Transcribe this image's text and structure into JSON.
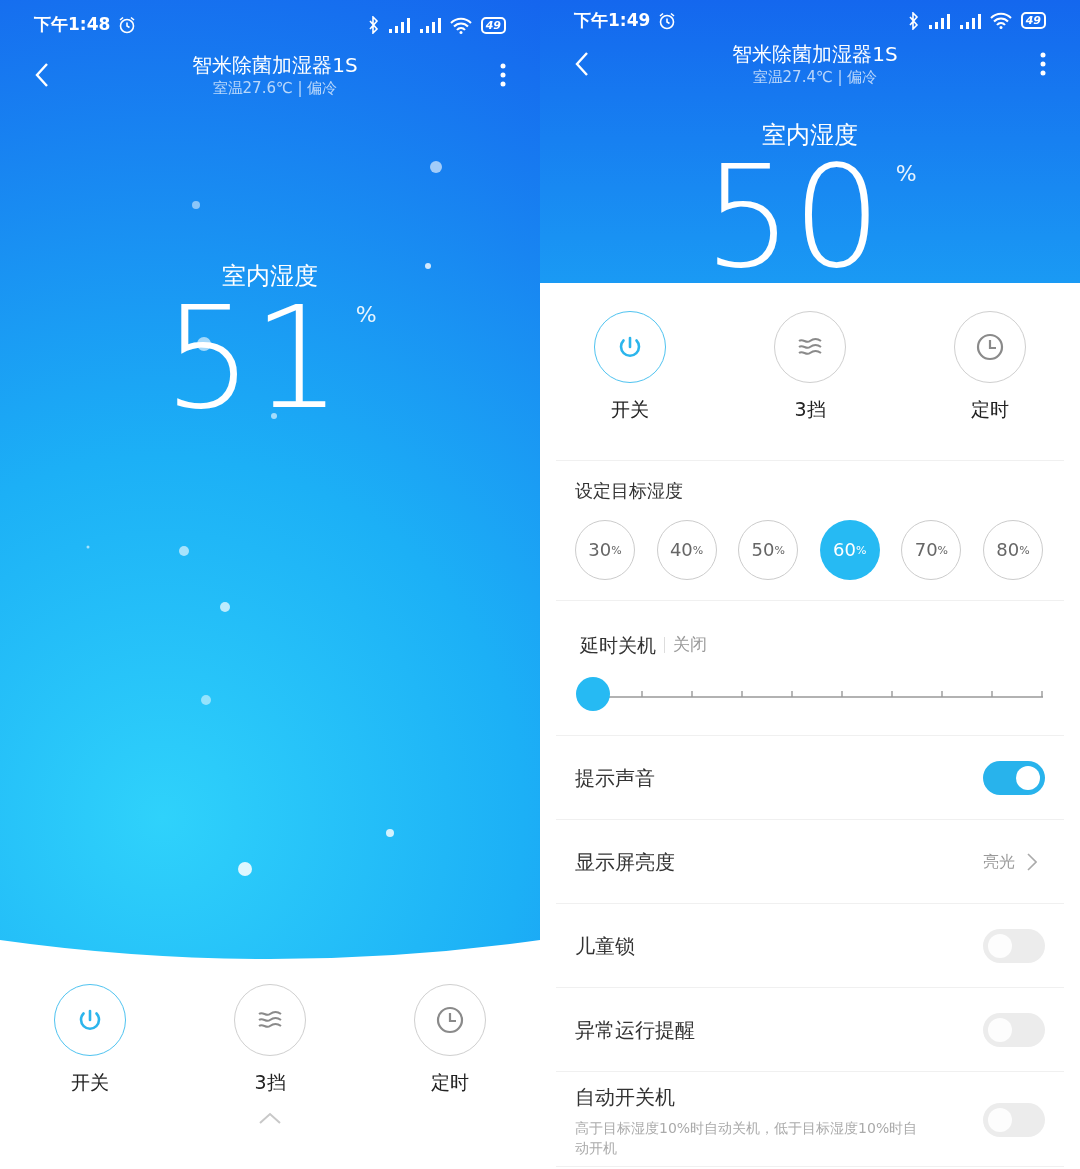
{
  "screens": [
    {
      "status_bar": {
        "time": "下午1:48",
        "battery": "49"
      },
      "header": {
        "title": "智米除菌加湿器1S",
        "subtitle": "室温27.6℃ | 偏冷"
      },
      "humidity": {
        "label": "室内湿度",
        "value": "51",
        "unit": "%"
      },
      "controls": [
        {
          "kind": "power",
          "label": "开关",
          "on": true
        },
        {
          "kind": "fan",
          "label": "3挡",
          "on": false
        },
        {
          "kind": "timer",
          "label": "定时",
          "on": false
        }
      ],
      "expand_arrow": true
    },
    {
      "status_bar": {
        "time": "下午1:49",
        "battery": "49"
      },
      "header": {
        "title": "智米除菌加湿器1S",
        "subtitle": "室温27.4℃ | 偏冷"
      },
      "humidity": {
        "label": "室内湿度",
        "value": "50",
        "unit": "%"
      },
      "controls": [
        {
          "kind": "power",
          "label": "开关",
          "on": true
        },
        {
          "kind": "fan",
          "label": "3挡",
          "on": false
        },
        {
          "kind": "timer",
          "label": "定时",
          "on": false
        }
      ],
      "target_humidity": {
        "label": "设定目标湿度",
        "options": [
          {
            "value": "30",
            "unit": "%",
            "selected": false
          },
          {
            "value": "40",
            "unit": "%",
            "selected": false
          },
          {
            "value": "50",
            "unit": "%",
            "selected": false
          },
          {
            "value": "60",
            "unit": "%",
            "selected": true
          },
          {
            "value": "70",
            "unit": "%",
            "selected": false
          },
          {
            "value": "80",
            "unit": "%",
            "selected": false
          }
        ]
      },
      "delay_off": {
        "label": "延时关机",
        "value": "关闭",
        "level": 0
      },
      "settings": [
        {
          "kind": "toggle",
          "label": "提示声音",
          "on": true
        },
        {
          "kind": "link",
          "label": "显示屏亮度",
          "value": "亮光"
        },
        {
          "kind": "toggle",
          "label": "儿童锁",
          "on": false
        },
        {
          "kind": "toggle",
          "label": "异常运行提醒",
          "on": false
        },
        {
          "kind": "toggle",
          "label": "自动开关机",
          "on": false,
          "description": "高于目标湿度10%时自动关机，低于目标湿度10%时自动开机"
        }
      ]
    }
  ]
}
